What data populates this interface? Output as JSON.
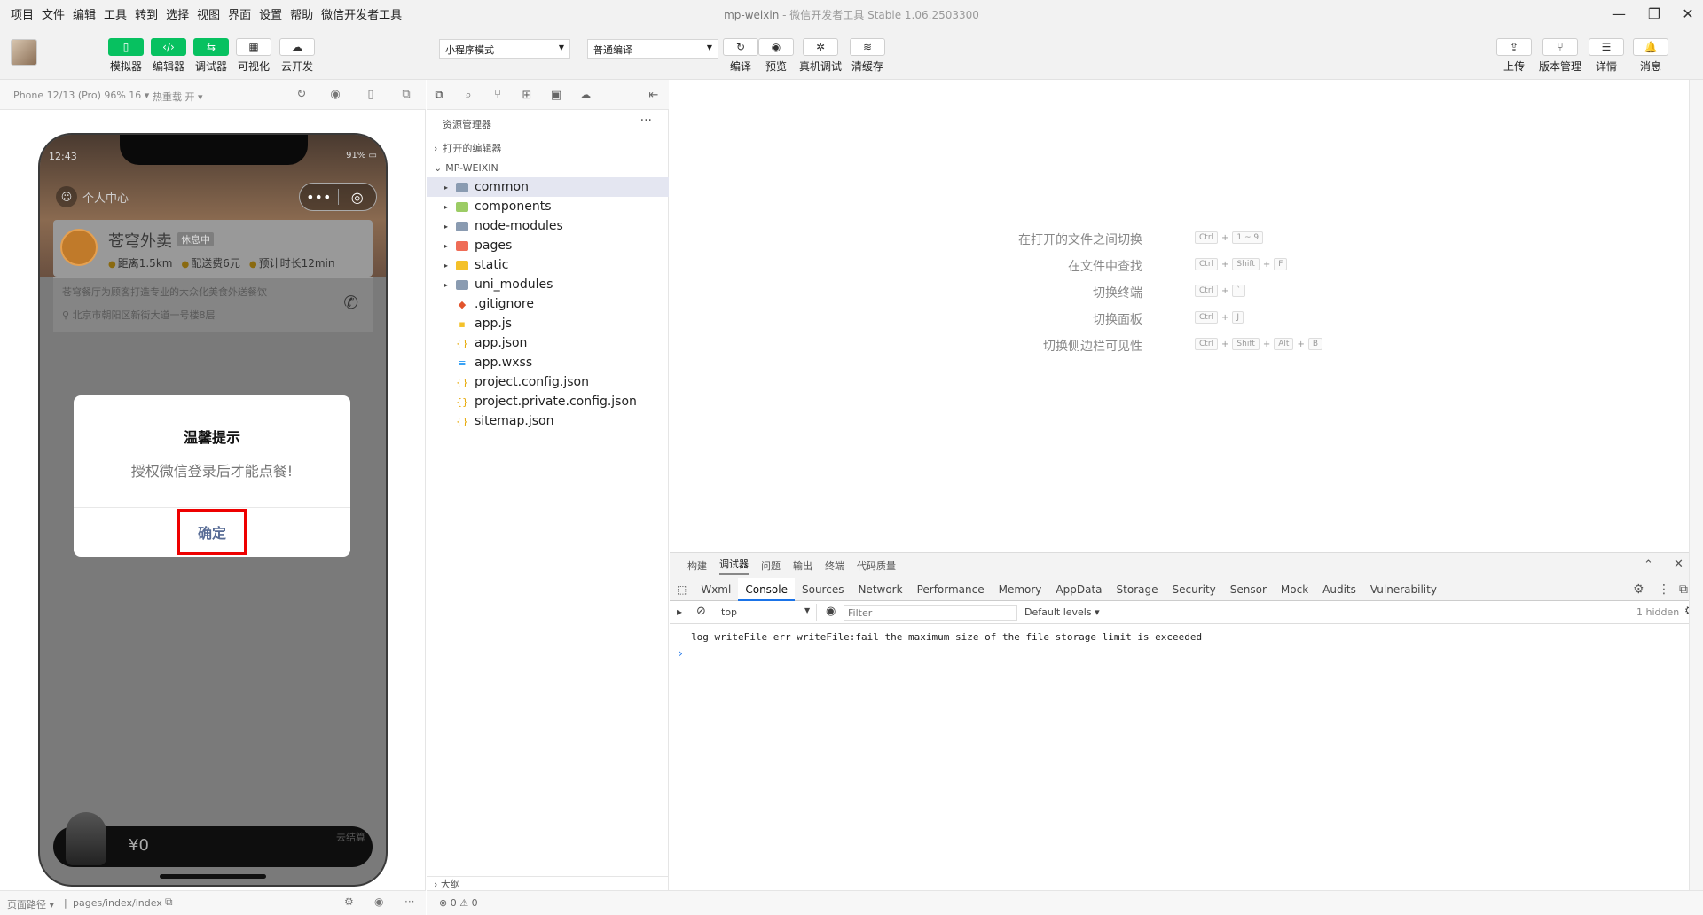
{
  "menubar": {
    "items": [
      "项目",
      "文件",
      "编辑",
      "工具",
      "转到",
      "选择",
      "视图",
      "界面",
      "设置",
      "帮助",
      "微信开发者工具"
    ],
    "title_app": "mp-weixin",
    "title_rest": " - 微信开发者工具 Stable 1.06.2503300"
  },
  "toolbar": {
    "left_buttons": [
      {
        "label": "模拟器",
        "icon": "phone-icon"
      },
      {
        "label": "编辑器",
        "icon": "code-icon"
      },
      {
        "label": "调试器",
        "icon": "debug-icon"
      },
      {
        "label": "可视化",
        "icon": "layout-icon"
      },
      {
        "label": "云开发",
        "icon": "cloud-icon"
      }
    ],
    "mode_select": "小程序模式",
    "compile_select": "普通编译",
    "center_buttons": [
      {
        "label": "编译",
        "icon": "refresh-icon"
      },
      {
        "label": "预览",
        "icon": "eye-icon"
      },
      {
        "label": "真机调试",
        "icon": "bug-icon"
      },
      {
        "label": "清缓存",
        "icon": "layers-icon"
      }
    ],
    "right_buttons": [
      {
        "label": "上传",
        "icon": "upload-icon"
      },
      {
        "label": "版本管理",
        "icon": "branch-icon"
      },
      {
        "label": "详情",
        "icon": "menu-icon"
      },
      {
        "label": "消息",
        "icon": "bell-icon"
      }
    ]
  },
  "simulator": {
    "device": "iPhone 12/13 (Pro) 96% 16 ▾",
    "hot_reload": "热重载 开 ▾",
    "status_time": "12:43",
    "status_battery": "91%",
    "center_label": "个人中心",
    "shop": {
      "name": "苍穹外卖",
      "badge": "休息中",
      "meta": [
        "距离1.5km",
        "配送费6元",
        "预计时长12min"
      ],
      "desc": "苍穹餐厅为顾客打造专业的大众化美食外送餐饮",
      "address": "北京市朝阳区新街大道一号楼8层"
    },
    "dialog": {
      "title": "温馨提示",
      "message": "授权微信登录后才能点餐!",
      "confirm": "确定"
    },
    "cart_price": "¥0",
    "cart_right": "去结算"
  },
  "sim_status": {
    "path_label": "页面路径 ▾",
    "path": "pages/index/index"
  },
  "explorer": {
    "title": "资源管理器",
    "more": "···",
    "section_open_editors": "打开的编辑器",
    "section_project": "MP-WEIXIN",
    "files": [
      {
        "name": "common",
        "type": "folder",
        "color": "",
        "arrow": "▸"
      },
      {
        "name": "components",
        "type": "folder",
        "color": "g",
        "arrow": "▸"
      },
      {
        "name": "node-modules",
        "type": "folder",
        "color": "",
        "arrow": "▸"
      },
      {
        "name": "pages",
        "type": "folder",
        "color": "r",
        "arrow": "▸"
      },
      {
        "name": "static",
        "type": "folder",
        "color": "y",
        "arrow": "▸"
      },
      {
        "name": "uni_modules",
        "type": "folder",
        "color": "",
        "arrow": "▸"
      },
      {
        "name": ".gitignore",
        "type": "git",
        "arrow": ""
      },
      {
        "name": "app.js",
        "type": "js",
        "arrow": ""
      },
      {
        "name": "app.json",
        "type": "json",
        "arrow": ""
      },
      {
        "name": "app.wxss",
        "type": "css",
        "arrow": ""
      },
      {
        "name": "project.config.json",
        "type": "json",
        "arrow": ""
      },
      {
        "name": "project.private.config.json",
        "type": "json",
        "arrow": ""
      },
      {
        "name": "sitemap.json",
        "type": "json",
        "arrow": ""
      }
    ],
    "outline": "大纲"
  },
  "editor": {
    "shortcuts": [
      {
        "label": "在打开的文件之间切换",
        "keys": [
          "Ctrl",
          "1 ~ 9"
        ]
      },
      {
        "label": "在文件中查找",
        "keys": [
          "Ctrl",
          "Shift",
          "F"
        ]
      },
      {
        "label": "切换终端",
        "keys": [
          "Ctrl",
          "`"
        ]
      },
      {
        "label": "切换面板",
        "keys": [
          "Ctrl",
          "J"
        ]
      },
      {
        "label": "切换侧边栏可见性",
        "keys": [
          "Ctrl",
          "Shift",
          "Alt",
          "B"
        ]
      }
    ]
  },
  "devtools": {
    "top_tabs": [
      "构建",
      "调试器",
      "问题",
      "输出",
      "终端",
      "代码质量"
    ],
    "active_top": "调试器",
    "panel_tabs": [
      "Wxml",
      "Console",
      "Sources",
      "Network",
      "Performance",
      "Memory",
      "AppData",
      "Storage",
      "Security",
      "Sensor",
      "Mock",
      "Audits",
      "Vulnerability"
    ],
    "active_panel": "Console",
    "context": "top",
    "filter_placeholder": "Filter",
    "levels": "Default levels ▾",
    "hidden": "1 hidden",
    "log": "log writeFile err writeFile:fail the maximum size of the file storage limit is exceeded",
    "prompt": "›"
  },
  "bottom_status": {
    "errors": "0",
    "warnings": "0"
  }
}
